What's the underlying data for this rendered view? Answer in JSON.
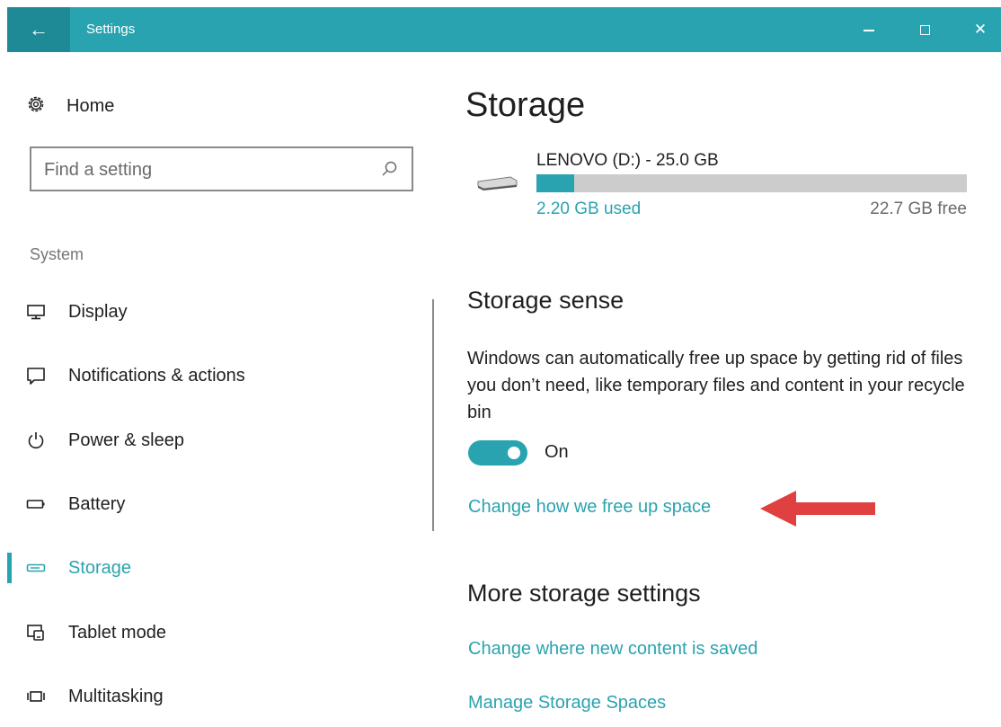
{
  "window": {
    "title": "Settings",
    "back_glyph": "←",
    "close_glyph": "✕",
    "accent_color": "#2aa3b0",
    "back_bg_color": "#1d8a96"
  },
  "sidebar": {
    "home_label": "Home",
    "home_icon": "gear-icon",
    "search_placeholder": "Find a setting",
    "section_label": "System",
    "items": [
      {
        "label": "Display",
        "icon": "monitor-icon",
        "active": false
      },
      {
        "label": "Notifications & actions",
        "icon": "notification-icon",
        "active": false
      },
      {
        "label": "Power & sleep",
        "icon": "power-icon",
        "active": false
      },
      {
        "label": "Battery",
        "icon": "battery-icon",
        "active": false
      },
      {
        "label": "Storage",
        "icon": "storage-icon",
        "active": true
      },
      {
        "label": "Tablet mode",
        "icon": "tablet-mode-icon",
        "active": false
      },
      {
        "label": "Multitasking",
        "icon": "multitasking-icon",
        "active": false
      }
    ]
  },
  "main": {
    "title": "Storage",
    "drive": {
      "name": "LENOVO (D:) - 25.0 GB",
      "used": "2.20 GB used",
      "free": "22.7 GB free",
      "used_fraction": 0.088,
      "icon": "drive-icon"
    },
    "storage_sense": {
      "heading": "Storage sense",
      "description": "Windows can automatically free up space by getting rid of files you don’t need, like temporary files and content in your recycle bin",
      "toggle_state": "On",
      "link": "Change how we free up space",
      "arrow_color": "#e04040"
    },
    "more": {
      "heading": "More storage settings",
      "links": [
        "Change where new content is saved",
        "Manage Storage Spaces"
      ]
    }
  }
}
